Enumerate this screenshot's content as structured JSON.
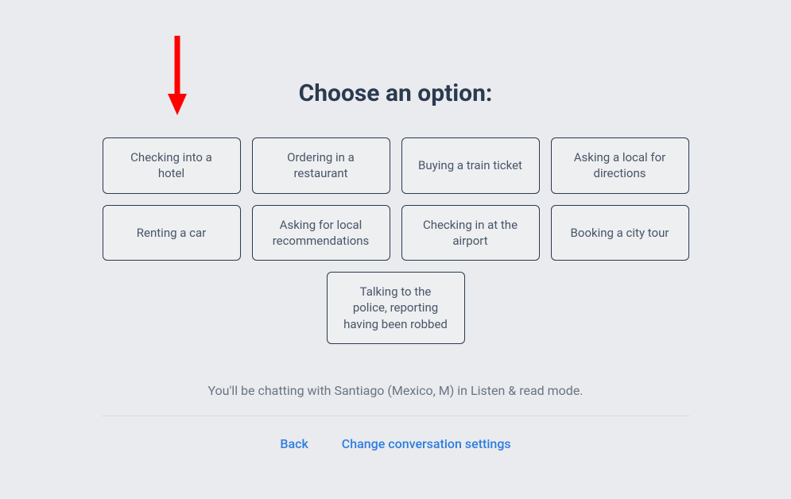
{
  "heading": "Choose an option:",
  "options": {
    "row1": [
      "Checking into a hotel",
      "Ordering in a restaurant",
      "Buying a train ticket",
      "Asking a local for directions"
    ],
    "row2": [
      "Renting a car",
      "Asking for local recommendations",
      "Checking in at the airport",
      "Booking a city tour"
    ],
    "row3": [
      "Talking to the police, reporting having been robbed"
    ]
  },
  "status_text": "You'll be chatting with Santiago (Mexico, M) in Listen & read mode.",
  "links": {
    "back": "Back",
    "change_settings": "Change conversation settings"
  },
  "annotation": {
    "arrow_color": "#ff0000"
  }
}
